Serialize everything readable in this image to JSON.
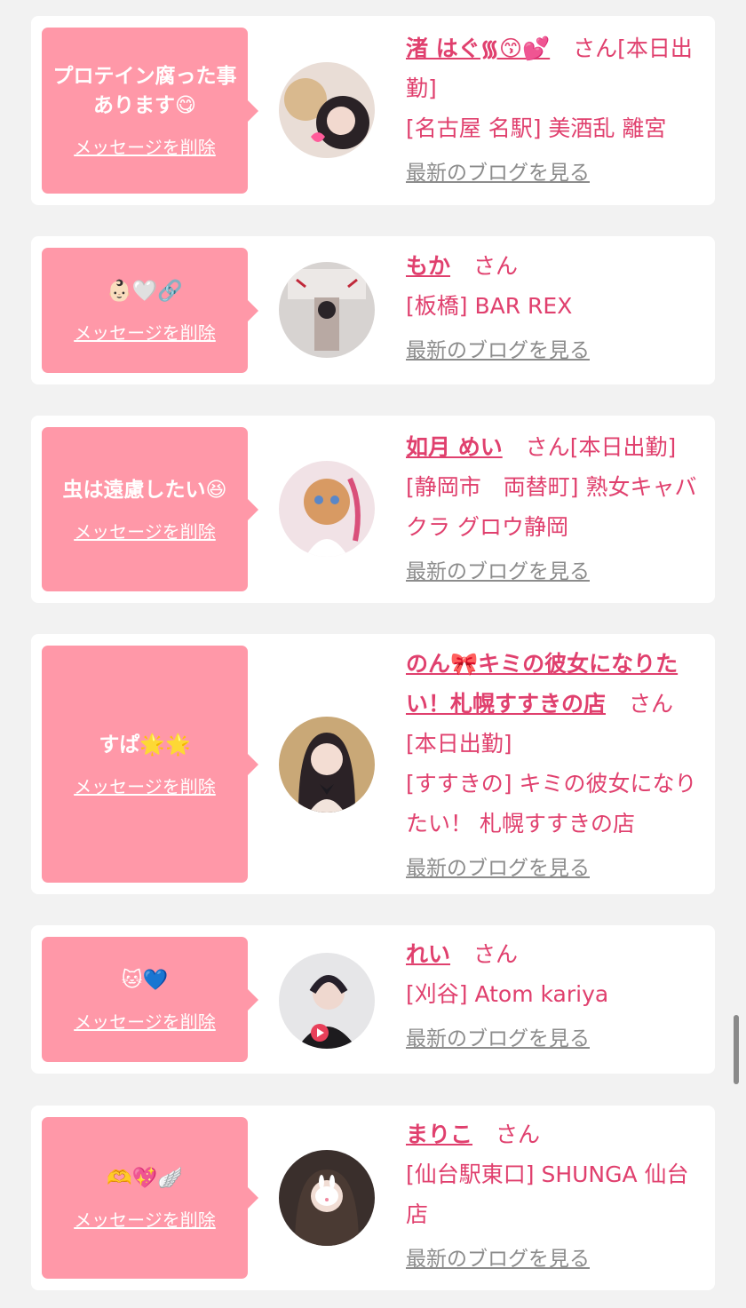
{
  "delete_label": "メッセージを削除",
  "blog_label": "最新のブログを見る",
  "san_label": "さん",
  "colors": {
    "accent": "#e0406e",
    "bubble": "#ff98a8",
    "background": "#f2f2f2",
    "link_gray": "#8c8c8c"
  },
  "cards": [
    {
      "message": "プロテイン腐った事あります😋",
      "name": "渚 はぐ᯾😙💕",
      "suffix": "[本日出勤]",
      "shop": "[名古屋 名駅] 美酒乱 離宮"
    },
    {
      "message": "👶🏻🤍🔗",
      "name": "もか",
      "suffix": "",
      "shop": "[板橋] BAR REX"
    },
    {
      "message": "虫は遠慮したい😆",
      "name": "如月 めい",
      "suffix": "[本日出勤]",
      "shop": "[静岡市　両替町] 熟女キャバクラ グロウ静岡"
    },
    {
      "message": "すぱ🌟🌟",
      "name": "のん🎀キミの彼女になりたい！札幌すすきの店",
      "suffix": "[本日出勤]",
      "shop": "[すすきの] キミの彼女になりたい！ 札幌すすきの店"
    },
    {
      "message": "🐱💙",
      "name": "れい",
      "suffix": "",
      "shop": "[刈谷] Atom kariya"
    },
    {
      "message": "🫶💖🪽",
      "name": "まりこ",
      "suffix": "",
      "shop": "[仙台駅東口] SHUNGA 仙台店"
    }
  ]
}
